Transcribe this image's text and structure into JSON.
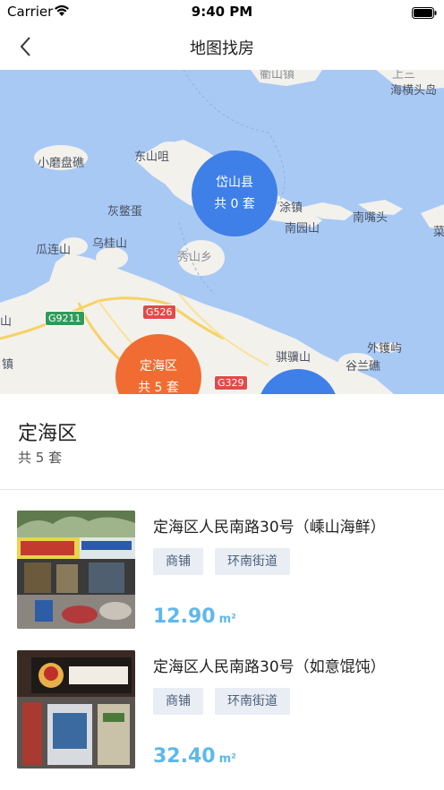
{
  "status_bar": {
    "carrier": "Carrier",
    "time": "9:40 PM"
  },
  "nav": {
    "title": "地图找房"
  },
  "map": {
    "places": {
      "top1": "衢山镇",
      "top2": "上三",
      "haihengtou": "海横头岛",
      "xiaomopan": "小磨盘礁",
      "dongshanzui": "东山咀",
      "huibiedan": "灰鳖蛋",
      "tuzhen": "涂镇",
      "nanzuitou": "南嘴头",
      "nanyuanshan": "南园山",
      "gualianshan": "瓜连山",
      "wuguishan": "乌桂山",
      "xiushanxiang": "秀山乡",
      "jimenshan": "骐骥山",
      "waiqiaoyu": "外镬屿",
      "gulanjiao": "谷兰礁",
      "edge_zhen": "镇",
      "edge_shan": "山",
      "edge_cai": "菜"
    },
    "roads": {
      "g9211": "G9211",
      "g526": "G526",
      "g329": "G329"
    },
    "clusters": [
      {
        "name": "岱山县",
        "count": "共 0 套"
      },
      {
        "name": "定海区",
        "count": "共 5 套"
      }
    ]
  },
  "district": {
    "name": "定海区",
    "count": "共 5 套"
  },
  "listings": [
    {
      "title": "定海区人民南路30号（嵊山海鲜）",
      "tags": [
        "商铺",
        "环南街道"
      ],
      "area": "12.90",
      "unit": "m²"
    },
    {
      "title": "定海区人民南路30号（如意馄饨）",
      "tags": [
        "商铺",
        "环南街道"
      ],
      "area": "32.40",
      "unit": "m²"
    }
  ]
}
